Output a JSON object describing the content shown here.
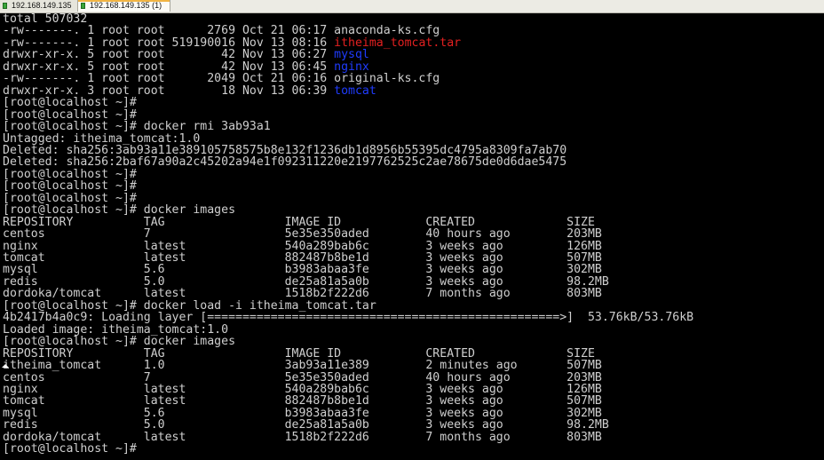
{
  "tabs": [
    {
      "label": "192.168.149.135"
    },
    {
      "label": "192.168.149.135 (1)"
    }
  ],
  "colors": {
    "background": "#000000",
    "text": "#cfcfcf",
    "red": "#e32020",
    "blue": "#1f3cff"
  },
  "terminal": {
    "lines": [
      {
        "segments": [
          {
            "text": "total 507032",
            "color": "default"
          }
        ]
      },
      {
        "segments": [
          {
            "text": "-rw-------. 1 root root      2769 Oct 21 06:17 anaconda-ks.cfg",
            "color": "default"
          }
        ]
      },
      {
        "segments": [
          {
            "text": "-rw-------. 1 root root 519190016 Nov 13 08:16 ",
            "color": "default"
          },
          {
            "text": "itheima_tomcat.tar",
            "color": "red"
          }
        ]
      },
      {
        "segments": [
          {
            "text": "drwxr-xr-x. 5 root root        42 Nov 13 06:27 ",
            "color": "default"
          },
          {
            "text": "mysql",
            "color": "blue"
          }
        ]
      },
      {
        "segments": [
          {
            "text": "drwxr-xr-x. 5 root root        42 Nov 13 06:45 ",
            "color": "default"
          },
          {
            "text": "nginx",
            "color": "blue"
          }
        ]
      },
      {
        "segments": [
          {
            "text": "-rw-------. 1 root root      2049 Oct 21 06:16 original-ks.cfg",
            "color": "default"
          }
        ]
      },
      {
        "segments": [
          {
            "text": "drwxr-xr-x. 3 root root        18 Nov 13 06:39 ",
            "color": "default"
          },
          {
            "text": "tomcat",
            "color": "blue"
          }
        ]
      },
      {
        "segments": [
          {
            "text": "[root@localhost ~]#",
            "color": "default"
          }
        ]
      },
      {
        "segments": [
          {
            "text": "[root@localhost ~]#",
            "color": "default"
          }
        ]
      },
      {
        "segments": [
          {
            "text": "[root@localhost ~]# docker rmi 3ab93a1",
            "color": "default"
          }
        ]
      },
      {
        "segments": [
          {
            "text": "Untagged: itheima_tomcat:1.0",
            "color": "default"
          }
        ]
      },
      {
        "segments": [
          {
            "text": "Deleted: sha256:3ab93a11e389105758575b8e132f1236db1d8956b55395dc4795a8309fa7ab70",
            "color": "default"
          }
        ]
      },
      {
        "segments": [
          {
            "text": "Deleted: sha256:2baf67a90a2c45202a94e1f092311220e2197762525c2ae78675de0d6dae5475",
            "color": "default"
          }
        ]
      },
      {
        "segments": [
          {
            "text": "[root@localhost ~]#",
            "color": "default"
          }
        ]
      },
      {
        "segments": [
          {
            "text": "[root@localhost ~]#",
            "color": "default"
          }
        ]
      },
      {
        "segments": [
          {
            "text": "[root@localhost ~]#",
            "color": "default"
          }
        ]
      },
      {
        "segments": [
          {
            "text": "[root@localhost ~]# docker images",
            "color": "default"
          }
        ]
      },
      {
        "segments": [
          {
            "text": "REPOSITORY          TAG                 IMAGE ID            CREATED             SIZE",
            "color": "default"
          }
        ]
      },
      {
        "segments": [
          {
            "text": "centos              7                   5e35e350aded        40 hours ago        203MB",
            "color": "default"
          }
        ]
      },
      {
        "segments": [
          {
            "text": "nginx               latest              540a289bab6c        3 weeks ago         126MB",
            "color": "default"
          }
        ]
      },
      {
        "segments": [
          {
            "text": "tomcat              latest              882487b8be1d        3 weeks ago         507MB",
            "color": "default"
          }
        ]
      },
      {
        "segments": [
          {
            "text": "mysql               5.6                 b3983abaa3fe        3 weeks ago         302MB",
            "color": "default"
          }
        ]
      },
      {
        "segments": [
          {
            "text": "redis               5.0                 de25a81a5a0b        3 weeks ago         98.2MB",
            "color": "default"
          }
        ]
      },
      {
        "segments": [
          {
            "text": "dordoka/tomcat      latest              1518b2f222d6        7 months ago        803MB",
            "color": "default"
          }
        ]
      },
      {
        "segments": [
          {
            "text": "[root@localhost ~]# docker load -i itheima_tomcat.tar",
            "color": "default"
          }
        ]
      },
      {
        "segments": [
          {
            "text": "4b2417b4a0c9: Loading layer [==================================================>]  53.76kB/53.76kB",
            "color": "default"
          }
        ]
      },
      {
        "segments": [
          {
            "text": "Loaded image: itheima_tomcat:1.0",
            "color": "default"
          }
        ]
      },
      {
        "segments": [
          {
            "text": "[root@localhost ~]# docker images",
            "color": "default"
          }
        ]
      },
      {
        "segments": [
          {
            "text": "REPOSITORY          TAG                 IMAGE ID            CREATED             SIZE",
            "color": "default"
          }
        ]
      },
      {
        "segments": [
          {
            "text": "itheima_tomcat      1.0                 3ab93a11e389        2 minutes ago       507MB",
            "color": "default"
          }
        ]
      },
      {
        "segments": [
          {
            "text": "centos              7                   5e35e350aded        40 hours ago        203MB",
            "color": "default"
          }
        ]
      },
      {
        "segments": [
          {
            "text": "nginx               latest              540a289bab6c        3 weeks ago         126MB",
            "color": "default"
          }
        ]
      },
      {
        "segments": [
          {
            "text": "tomcat              latest              882487b8be1d        3 weeks ago         507MB",
            "color": "default"
          }
        ]
      },
      {
        "segments": [
          {
            "text": "mysql               5.6                 b3983abaa3fe        3 weeks ago         302MB",
            "color": "default"
          }
        ]
      },
      {
        "segments": [
          {
            "text": "redis               5.0                 de25a81a5a0b        3 weeks ago         98.2MB",
            "color": "default"
          }
        ]
      },
      {
        "segments": [
          {
            "text": "dordoka/tomcat      latest              1518b2f222d6        7 months ago        803MB",
            "color": "default"
          }
        ]
      },
      {
        "segments": [
          {
            "text": "[root@localhost ~]#",
            "color": "default"
          }
        ]
      }
    ]
  }
}
